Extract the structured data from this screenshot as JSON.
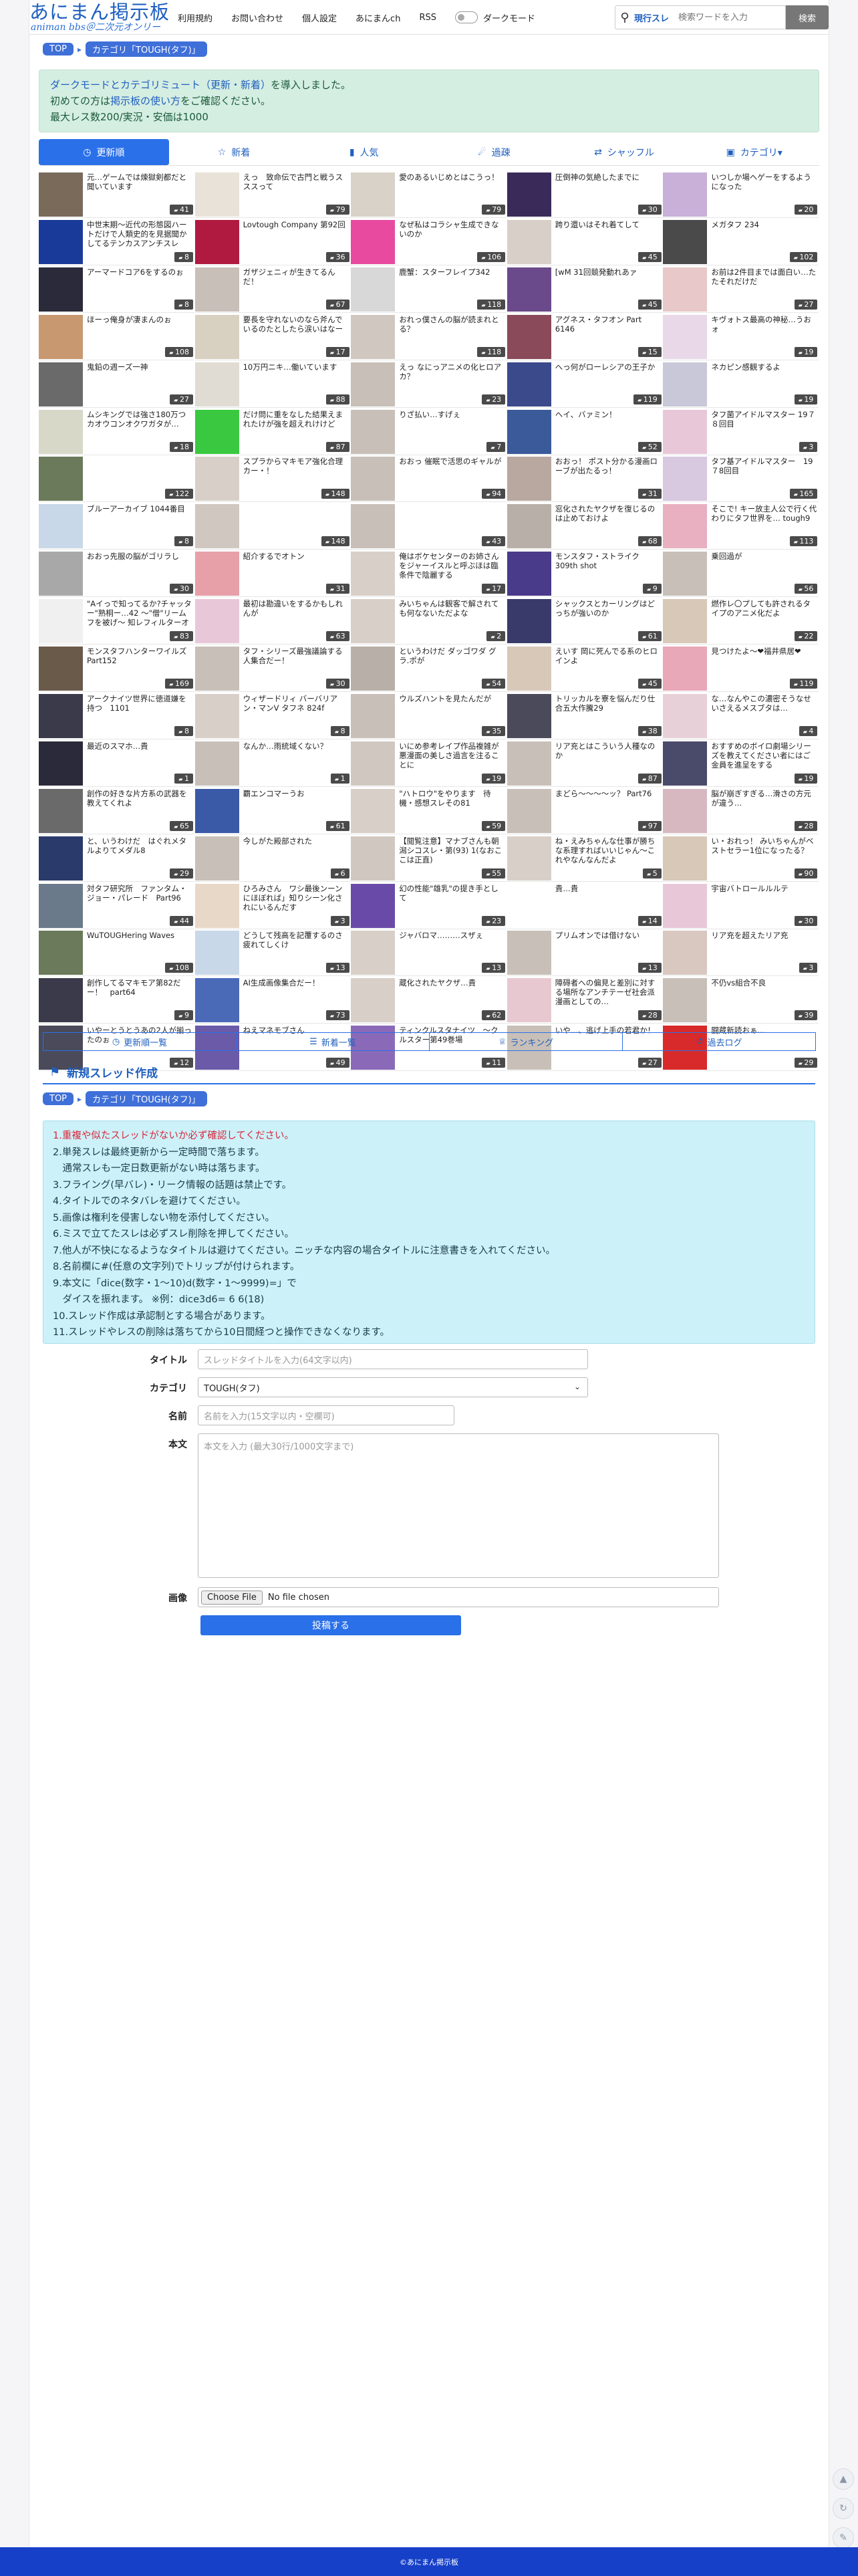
{
  "header": {
    "logo_main": "あにまん掲示板",
    "logo_sub": "animan bbs＠二次元オンリー",
    "nav": [
      "利用規約",
      "お問い合わせ",
      "個人設定",
      "あにまんch",
      "RSS"
    ],
    "dark_mode_label": "ダークモード",
    "search_scope": "現行スレ",
    "search_placeholder": "検索ワードを入力",
    "search_button": "検索"
  },
  "breadcrumb": [
    "TOP",
    "カテゴリ「TOUGH(タフ)」"
  ],
  "notice": {
    "line1_link": "ダークモードとカテゴリミュート（更新・新着）",
    "line1_rest": "を導入しました。",
    "line2_pre": "初めての方は",
    "line2_link": "掲示板の使い方",
    "line2_post": "をご確認ください。",
    "line3": "最大レス数200/実況・安価は1000"
  },
  "tabs": [
    {
      "label": "更新順",
      "icon": "clock-icon",
      "active": true
    },
    {
      "label": "新着",
      "icon": "star-icon",
      "active": false
    },
    {
      "label": "人気",
      "icon": "bar-chart-icon",
      "active": false
    },
    {
      "label": "過疎",
      "icon": "megaphone-icon",
      "active": false
    },
    {
      "label": "シャッフル",
      "icon": "shuffle-icon",
      "active": false
    },
    {
      "label": "カテゴリ▾",
      "icon": "folder-icon",
      "active": false
    }
  ],
  "threads": [
    {
      "title": "元…ゲームでは煉獄剣都だと聞いています",
      "count": "41",
      "color": "#7a6a5a"
    },
    {
      "title": "えっ　致命伝で古門と戦うスススって",
      "count": "79",
      "color": "#e8e2d8"
    },
    {
      "title": "愛のあるいじめとはこうっ！",
      "count": "79",
      "color": "#d8d2c8"
    },
    {
      "title": "圧倒神の気絶したまでに",
      "count": "30",
      "color": "#3a2a5a"
    },
    {
      "title": "いつしか場ヘゲーをするようになった",
      "count": "20",
      "color": "#c8b0d8"
    },
    {
      "title": "中世末期〜近代の形態図ハートだけで人類史的を見据聞かしてるテンカスアンチスレ",
      "count": "8",
      "color": "#1a3a9a"
    },
    {
      "title": "Lovtough Company 第92回",
      "count": "36",
      "color": "#b01a40"
    },
    {
      "title": "なぜ私はコラシャ生成できないのか",
      "count": "106",
      "color": "#e84aa0"
    },
    {
      "title": "跨り還いはそれ着てして",
      "count": "45",
      "color": "#d8d0c8"
    },
    {
      "title": "メガタフ 234",
      "count": "102",
      "color": "#4a4a4a"
    },
    {
      "title": "アーマードコア6をするのぉ",
      "count": "8",
      "color": "#2a2a3a"
    },
    {
      "title": "ガザジェニィが生きてるんだ！",
      "count": "67",
      "color": "#c8c0b8"
    },
    {
      "title": "鹿蟹：スターフレイプ342",
      "count": "118",
      "color": "#d8d8d8"
    },
    {
      "title": "[wM 31回競発動れあァ",
      "count": "45",
      "color": "#6a4a8a"
    },
    {
      "title": "お前は2件目までは面白い…たたそれだけだ",
      "count": "27",
      "color": "#e8c8c8"
    },
    {
      "title": "ほーっ俺身が凄まんのぉ",
      "count": "108",
      "color": "#c89870"
    },
    {
      "title": "要長を守れないのなら斧んでいるのたとしたら涙いはなー",
      "count": "17",
      "color": "#d8d0c0"
    },
    {
      "title": "おれっ僕さんの脳が読まれとる？",
      "count": "118",
      "color": "#d0c8c0"
    },
    {
      "title": "アグネス・タフオン Part 6146",
      "count": "15",
      "color": "#8a4a5a"
    },
    {
      "title": "キヴォトス最高の神秘…うおォ",
      "count": "19",
      "color": "#e8d8e8"
    },
    {
      "title": "鬼鉛の週ーズ一神",
      "count": "27",
      "color": "#6a6a6a"
    },
    {
      "title": "10万円ニキ…働いています",
      "count": "88",
      "color": "#e0dcd4"
    },
    {
      "title": "えっ なにっアニメの化ヒロアカ？",
      "count": "23",
      "color": "#c8c0b8"
    },
    {
      "title": "へっ何がローレシアの王子か",
      "count": "119",
      "color": "#3a4a8a"
    },
    {
      "title": "ネカピン感観するよ",
      "count": "19",
      "color": "#c8c8d8"
    },
    {
      "title": "ムシキングでは強さ180万つカオウコンオクワガタが…",
      "count": "18",
      "color": "#d8d8c8"
    },
    {
      "title": "だけ問に重をなした結果えまれたけが強を超えれけけど",
      "count": "87",
      "color": "#3ac840"
    },
    {
      "title": "りざ払い…すげぇ",
      "count": "7",
      "color": "#c8c0b8"
    },
    {
      "title": "ヘイ、バァミン！",
      "count": "52",
      "color": "#3a5a9a"
    },
    {
      "title": "タフ菌アイドルマスター 19７８回目",
      "count": "3",
      "color": "#e8c8d8"
    },
    {
      "title": "",
      "count": "122",
      "color": "#6a7a5a"
    },
    {
      "title": "スプラからマキモア強化合理カー・！",
      "count": "148",
      "color": "#d8d0c8"
    },
    {
      "title": "おおっ 催眠で活思のギャルが",
      "count": "94",
      "color": "#c8c0b8"
    },
    {
      "title": "おおっ！ ポスト分かる漫画ローブが出たるっ！",
      "count": "31",
      "color": "#b8a8a0"
    },
    {
      "title": "タフ基アイドルマスター　19７8回目",
      "count": "165",
      "color": "#d8c8e0"
    },
    {
      "title": "ブルーアーカイブ 1044番目",
      "count": "8",
      "color": "#c8d8e8"
    },
    {
      "title": "",
      "count": "148",
      "color": "#d0c8c0"
    },
    {
      "title": "",
      "count": "43",
      "color": "#c8c0b8"
    },
    {
      "title": "窓化されたヤクザを復じるのは止めておけよ",
      "count": "68",
      "color": "#b8b0a8"
    },
    {
      "title": "そこで! キー放主人公で行く代わりにタフ世界を… tough9",
      "count": "113",
      "color": "#e8b0c0"
    },
    {
      "title": "おおっ先服の脳がゴリラし",
      "count": "30",
      "color": "#a8a8a8"
    },
    {
      "title": "紹介するでオトン",
      "count": "31",
      "color": "#e8a0a8"
    },
    {
      "title": "俺はボケセンターのお姉さんをジャーイスルと呼ぶほは臨条件で陰麗する",
      "count": "17",
      "color": "#d8d0c8"
    },
    {
      "title": "モンスタフ・ストライク 309th shot",
      "count": "9",
      "color": "#4a3a8a"
    },
    {
      "title": "乗回過が",
      "count": "56",
      "color": "#c8c0b8"
    },
    {
      "title": "\"Aイっで知ってるか?チャッター\"熟桐ー…42 ～\"僧\"リームフを被げ～ 知レフィルターオフ",
      "count": "83",
      "color": "#f0f0f0"
    },
    {
      "title": "最初は勘違いをするかもしれんが",
      "count": "63",
      "color": "#e8c8d8"
    },
    {
      "title": "みいちゃんは観客で解されても何なないただよな",
      "count": "2",
      "color": "#d8d0c8"
    },
    {
      "title": "シャックスとカーリングはどっちが強いのか",
      "count": "61",
      "color": "#3a3a6a"
    },
    {
      "title": "燃作レ〇プしても許されるタイプのアニメ化だよ",
      "count": "22",
      "color": "#d8c8b8"
    },
    {
      "title": "モンスタフハンターワイルズPart152",
      "count": "169",
      "color": "#6a5a4a"
    },
    {
      "title": "タフ・シリーズ最強議論する人集合だー！",
      "count": "30",
      "color": "#c8c0b8"
    },
    {
      "title": "というわけだ ダッゴワダ グラ.ポが",
      "count": "54",
      "color": "#b8b0a8"
    },
    {
      "title": "えいす 岡に死んでる系のヒロインよ",
      "count": "45",
      "color": "#d8c8b8"
    },
    {
      "title": "見つけたよ〜❤福井県居❤",
      "count": "119",
      "color": "#e8a8b8"
    },
    {
      "title": "アークナイツ世界に徳道嫌を持つ　1101",
      "count": "8",
      "color": "#3a3a4a"
    },
    {
      "title": "ウィザードリィ バーバリアン・マンV タフネ 824f",
      "count": "8",
      "color": "#d8d0c8"
    },
    {
      "title": "ウルズハントを見たんだが",
      "count": "35",
      "color": "#c8c0b8"
    },
    {
      "title": "トリッカルを寮を悩んだり仕合五大作騰29",
      "count": "38",
      "color": "#4a4a5a"
    },
    {
      "title": "な…なんやこの濃密そうなせいさえるメスブタは…",
      "count": "4",
      "color": "#e8d0d8"
    },
    {
      "title": "最近のスマホ…貴",
      "count": "1",
      "color": "#2a2a3a"
    },
    {
      "title": "なんか…雨統域くない？",
      "count": "1",
      "color": "#c8c0b8"
    },
    {
      "title": "いにめ参考レイプ作品複雑が悪漫面の美しさ過言を注ることに",
      "count": "19",
      "color": "#d0c8c0"
    },
    {
      "title": "リア充とはこういう人種なのか",
      "count": "87",
      "color": "#c8c0b8"
    },
    {
      "title": "おすすめのボイロ劇場シリーズを教えてください者にはご金員を進呈をする",
      "count": "19",
      "color": "#4a4a6a"
    },
    {
      "title": "創作の好きな片方系の武器を教えてくれよ",
      "count": "65",
      "color": "#6a6a6a"
    },
    {
      "title": "覇エンコマーうお",
      "count": "61",
      "color": "#3a5aa8"
    },
    {
      "title": "\"ハトロウ\"をやります　待機・感想スレその81",
      "count": "59",
      "color": "#d8d0c8"
    },
    {
      "title": "まどら〜〜〜〜ッ？ Part76",
      "count": "97",
      "color": "#c8c0b8"
    },
    {
      "title": "脳が崩ぎすぎる…滑さの方元が違う…",
      "count": "28",
      "color": "#d8b8c0"
    },
    {
      "title": "と、いうわけだ　はぐれメタルよりてメダル8",
      "count": "29",
      "color": "#2a3a6a"
    },
    {
      "title": "今しがた殿部された",
      "count": "6",
      "color": "#c8c0b8"
    },
    {
      "title": "【閲覧注意】マナブさんも朝潟シコスレ・第(93) 1(なおここは正直)",
      "count": "55",
      "color": "#d0c8c0"
    },
    {
      "title": "ね・えみちゃんな仕事が勝ちな系理すればいいじゃん～これやなんなんだよ",
      "count": "5",
      "color": "#d8d0c8"
    },
    {
      "title": "い・おれっ！ みいちゃんがベストセラー1位になったる？",
      "count": "90",
      "color": "#d8c8b8"
    },
    {
      "title": "対タフ研究所　ファンタム・ジョー・パレード　Part96",
      "count": "44",
      "color": "#6a7a8a"
    },
    {
      "title": "ひろみさん　ワシ最後ンーンにほぼれば」知りシーン化されにいるんだす",
      "count": "3",
      "color": "#e8d8c8"
    },
    {
      "title": "幻の性能\"雄乳\"の提き手として",
      "count": "23",
      "color": "#6a4aa8"
    },
    {
      "title": "貴…貴",
      "count": "14",
      "color": "#ffffff"
    },
    {
      "title": "宇宙バトロールルルテ",
      "count": "30",
      "color": "#e8c8d8"
    },
    {
      "title": "WuTOUGHering Waves",
      "count": "108",
      "color": "#6a7a5a"
    },
    {
      "title": "どうして残高を記覆するのさ疲れてしくけ",
      "count": "13",
      "color": "#c8d8e8"
    },
    {
      "title": "ジャバロマ………スザぇ",
      "count": "13",
      "color": "#d8d0c8"
    },
    {
      "title": "プリムオンでは借けない",
      "count": "13",
      "color": "#c8c0b8"
    },
    {
      "title": "リア充を超えたリア充",
      "count": "3",
      "color": "#d8c8c0"
    },
    {
      "title": "創作してるマキモア第82だー！　part64",
      "count": "9",
      "color": "#3a3a4a"
    },
    {
      "title": "AI生成画像集合だー！",
      "count": "73",
      "color": "#4a6ab8"
    },
    {
      "title": "蔵化されたヤクザ…貴",
      "count": "62",
      "color": "#d8d0c8"
    },
    {
      "title": "障碍者への偏見と差別に対する場所なアンチテーゼ社会派漫画としての…",
      "count": "28",
      "color": "#e8c8d0"
    },
    {
      "title": "不仍vs組合不良",
      "count": "39",
      "color": "#c8c0b8"
    },
    {
      "title": "いやーとうとうあの2人が揃ったのぉ",
      "count": "12",
      "color": "#4a4a5a"
    },
    {
      "title": "ねえマネモブさん",
      "count": "49",
      "color": "#6a5aa8"
    },
    {
      "title": "ティンクルスタナイツ　〜クルスター第49巻場",
      "count": "11",
      "color": "#8a6ab8"
    },
    {
      "title": "いや…、逃げ上手の若君か！",
      "count": "27",
      "color": "#c8c0b8"
    },
    {
      "title": "闘蔵新読おぁ…",
      "count": "29",
      "color": "#d82a2a"
    }
  ],
  "bottom_links": [
    {
      "label": "更新順一覧",
      "icon": "clock-icon"
    },
    {
      "label": "新着一覧",
      "icon": "list-icon"
    },
    {
      "label": "ランキング",
      "icon": "trophy-icon"
    },
    {
      "label": "過去ログ",
      "icon": "history-icon"
    }
  ],
  "new_thread": {
    "title": "新規スレッド作成",
    "rules": [
      "1.重複や似たスレッドがないか必ず確認してください。",
      "2.単発スレは最終更新から一定時間で落ちます。",
      "　通常スレも一定日数更新がない時は落ちます。",
      "3.フライング(早バレ)・リーク情報の話題は禁止です。",
      "4.タイトルでのネタバレを避けてください。",
      "5.画像は権利を侵害しない物を添付してください。",
      "6.ミスで立てたスレは必ずスレ削除を押してください。",
      "7.他人が不快になるようなタイトルは避けてください。ニッチな内容の場合タイトルに注意書きを入れてください。",
      "8.名前欄に#(任意の文字列)でトリップが付けられます。",
      "9.本文に「dice(数字・1〜10)d(数字・1〜9999)=」で",
      "　ダイスを振れます。 ※例：dice3d6= 6 6(18)",
      "10.スレッド作成は承認制とする場合があります。",
      "11.スレッドやレスの削除は落ちてから10日間経つと操作できなくなります。"
    ],
    "form": {
      "title_label": "タイトル",
      "title_placeholder": "スレッドタイトルを入力(64文字以内)",
      "category_label": "カテゴリ",
      "category_value": "TOUGH(タフ)",
      "name_label": "名前",
      "name_placeholder": "名前を入力(15文字以内・空欄可)",
      "body_label": "本文",
      "body_placeholder": "本文を入力 (最大30行/1000文字まで)",
      "image_label": "画像",
      "file_button": "Choose File",
      "file_status": "No file chosen",
      "submit": "投稿する"
    }
  },
  "footer": "©あにまん掲示板"
}
